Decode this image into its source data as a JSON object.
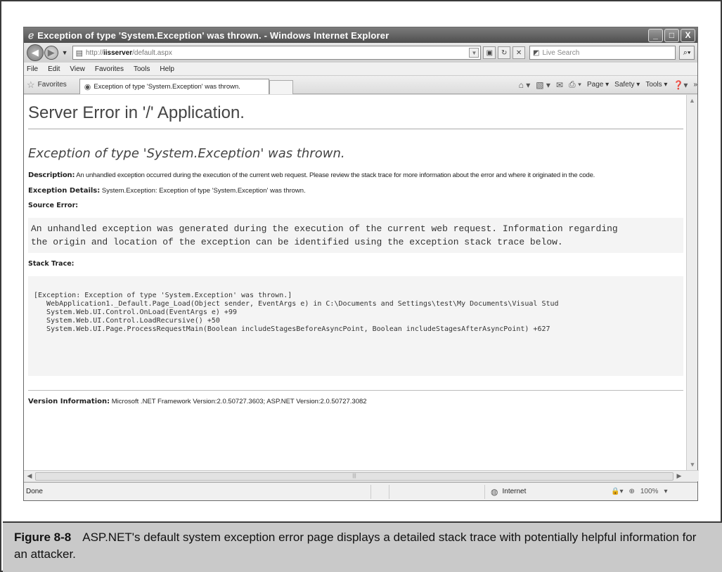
{
  "window": {
    "title": "Exception of type 'System.Exception' was thrown. - Windows Internet Explorer",
    "buttons": {
      "minimize": "_",
      "maximize": "□",
      "close": "X"
    }
  },
  "address_bar": {
    "url_prefix": "http://",
    "url_host": "iisserver",
    "url_path": "/default.aspx",
    "search_placeholder": "Live Search"
  },
  "menu": {
    "items": [
      "File",
      "Edit",
      "View",
      "Favorites",
      "Tools",
      "Help"
    ]
  },
  "favorites_bar": {
    "favorites_label": "Favorites",
    "tab_title": "Exception of type 'System.Exception' was thrown.",
    "commands": [
      "Page ▾",
      "Safety ▾",
      "Tools ▾"
    ]
  },
  "page": {
    "heading": "Server Error in '/' Application.",
    "exception_title": "Exception of type 'System.Exception' was thrown.",
    "description_label": "Description:",
    "description_text": " An unhandled exception occurred during the execution of the current web request. Please review the stack trace for more information about the error and where it originated in the code.",
    "details_label": "Exception Details:",
    "details_text": " System.Exception: Exception of type 'System.Exception' was thrown.",
    "source_error_label": "Source Error:",
    "source_error_text": "An unhandled exception was generated during the execution of the current web request. Information regarding\nthe origin and location of the exception can be identified using the exception stack trace below.",
    "stack_trace_label": "Stack Trace:",
    "stack_trace_text": "[Exception: Exception of type 'System.Exception' was thrown.]\n   WebApplication1._Default.Page_Load(Object sender, EventArgs e) in C:\\Documents and Settings\\test\\My Documents\\Visual Stud\n   System.Web.UI.Control.OnLoad(EventArgs e) +99\n   System.Web.UI.Control.LoadRecursive() +50\n   System.Web.UI.Page.ProcessRequestMain(Boolean includeStagesBeforeAsyncPoint, Boolean includeStagesAfterAsyncPoint) +627",
    "version_label": "Version Information:",
    "version_text": " Microsoft .NET Framework Version:2.0.50727.3603; ASP.NET Version:2.0.50727.3082"
  },
  "status_bar": {
    "status": "Done",
    "zone": "Internet",
    "zoom": "100%"
  },
  "caption": {
    "figure": "Figure 8-8",
    "text": "ASP.NET's default system exception error page displays a detailed stack trace with potentially helpful information for an attacker."
  }
}
